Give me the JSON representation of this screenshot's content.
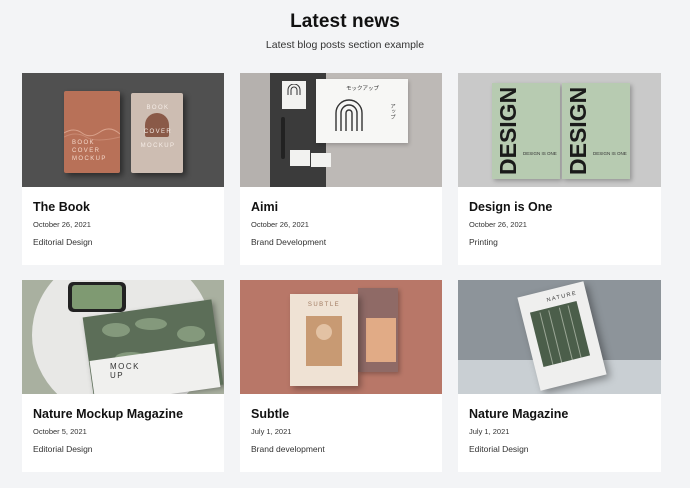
{
  "header": {
    "title": "Latest news",
    "subtitle": "Latest blog posts section example"
  },
  "posts": [
    {
      "title": "The Book",
      "date": "October 26, 2021",
      "category": "Editorial Design",
      "image_text": [
        "BOOK",
        "COVER",
        "MOCKUP"
      ]
    },
    {
      "title": "Aimi",
      "date": "October 26, 2021",
      "category": "Brand Development",
      "image_text": [
        "モックアップ",
        "アップ"
      ]
    },
    {
      "title": "Design is One",
      "date": "October 26, 2021",
      "category": "Printing",
      "image_text": [
        "DESIGN",
        "DESIGN IS ONE"
      ]
    },
    {
      "title": "Nature Mockup Magazine",
      "date": "October 5, 2021",
      "category": "Editorial Design",
      "image_text": [
        "MOCK",
        "UP"
      ]
    },
    {
      "title": "Subtle",
      "date": "July 1, 2021",
      "category": "Brand development",
      "image_text": [
        "SUBTLE"
      ]
    },
    {
      "title": "Nature Magazine",
      "date": "July 1, 2021",
      "category": "Editorial Design",
      "image_text": [
        "NATURE"
      ]
    }
  ]
}
